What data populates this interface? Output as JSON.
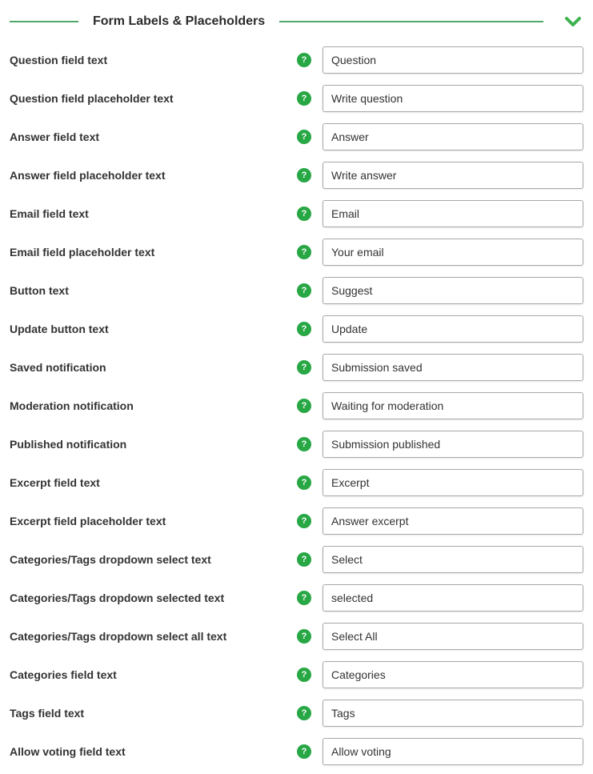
{
  "section": {
    "title": "Form Labels & Placeholders",
    "help_icon_text": "?"
  },
  "fields": [
    {
      "label": "Question field text",
      "value": "Question"
    },
    {
      "label": "Question field placeholder text",
      "value": "Write question"
    },
    {
      "label": "Answer field text",
      "value": "Answer"
    },
    {
      "label": "Answer field placeholder text",
      "value": "Write answer"
    },
    {
      "label": "Email field text",
      "value": "Email"
    },
    {
      "label": "Email field placeholder text",
      "value": "Your email"
    },
    {
      "label": "Button text",
      "value": "Suggest"
    },
    {
      "label": "Update button text",
      "value": "Update"
    },
    {
      "label": "Saved notification",
      "value": "Submission saved"
    },
    {
      "label": "Moderation notification",
      "value": "Waiting for moderation"
    },
    {
      "label": "Published notification",
      "value": "Submission published"
    },
    {
      "label": "Excerpt field text",
      "value": "Excerpt"
    },
    {
      "label": "Excerpt field placeholder text",
      "value": "Answer excerpt"
    },
    {
      "label": "Categories/Tags dropdown select text",
      "value": "Select"
    },
    {
      "label": "Categories/Tags dropdown selected text",
      "value": "selected"
    },
    {
      "label": "Categories/Tags dropdown select all text",
      "value": "Select All"
    },
    {
      "label": "Categories field text",
      "value": "Categories"
    },
    {
      "label": "Tags field text",
      "value": "Tags"
    },
    {
      "label": "Allow voting field text",
      "value": "Allow voting"
    }
  ]
}
